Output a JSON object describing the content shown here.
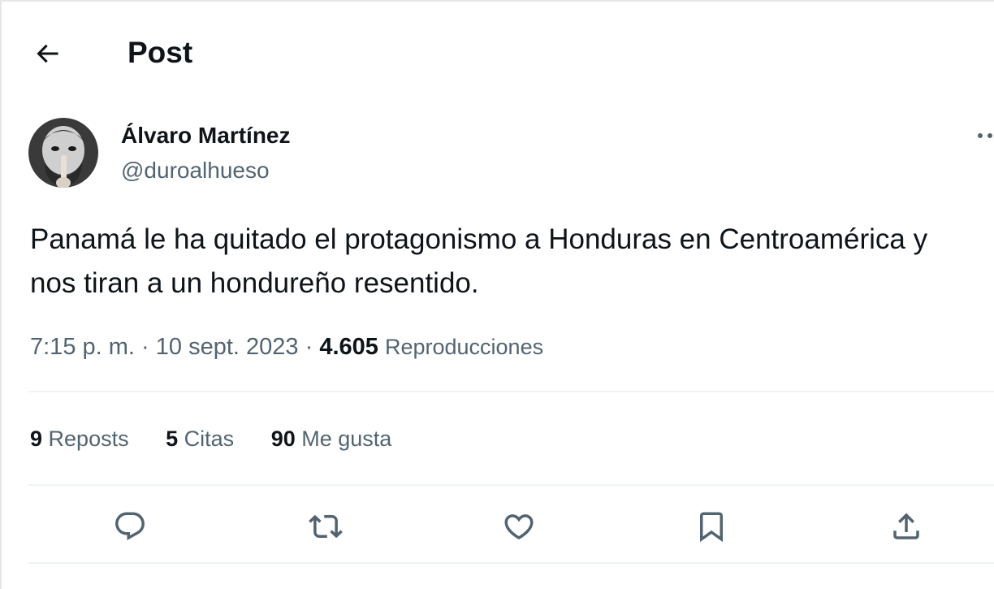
{
  "header": {
    "title": "Post",
    "back_icon": "arrow-left-icon"
  },
  "author": {
    "display_name": "Álvaro Martínez",
    "handle": "@duroalhueso",
    "avatar_icon": "profile-photo"
  },
  "post": {
    "text": "Panamá le ha quitado el protagonismo a Honduras en Centroamérica y\nnos tiran a un hondureño resentido.",
    "time": "7:15 p. m.",
    "separator": "·",
    "date": "10 sept. 2023",
    "views_count": "4.605",
    "views_label": "Reproducciones"
  },
  "stats": {
    "reposts_count": "9",
    "reposts_label": "Reposts",
    "quotes_count": "5",
    "quotes_label": "Citas",
    "likes_count": "90",
    "likes_label": "Me gusta"
  },
  "actions": [
    {
      "icon": "reply-icon"
    },
    {
      "icon": "repost-icon"
    },
    {
      "icon": "like-icon"
    },
    {
      "icon": "bookmark-icon"
    },
    {
      "icon": "share-icon"
    }
  ],
  "colors": {
    "text_primary": "#0f1419",
    "text_secondary": "#536471",
    "divider": "#eff3f4"
  }
}
